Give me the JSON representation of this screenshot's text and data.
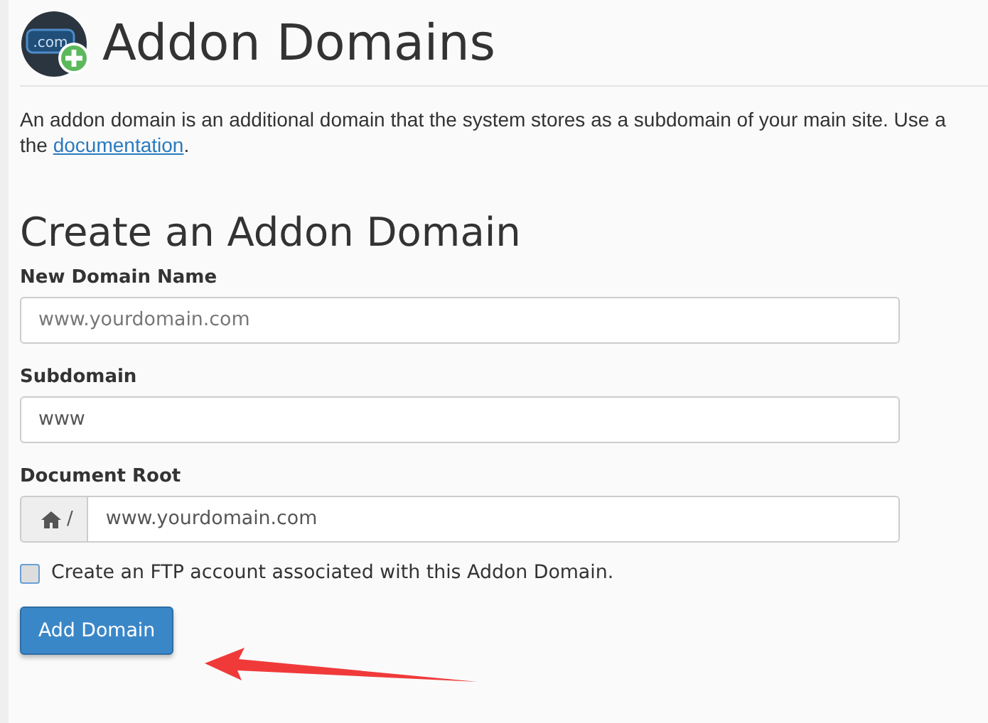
{
  "header": {
    "title": "Addon Domains",
    "icon_text": ".com"
  },
  "intro": {
    "text": "An addon domain is an additional domain that the system stores as a subdomain of your main site. Use a",
    "continuation": "the",
    "link": "documentation",
    "end": "."
  },
  "form": {
    "title": "Create an Addon Domain",
    "fields": [
      {
        "kind": "text",
        "label": "New Domain Name",
        "placeholder": "www.yourdomain.com"
      },
      {
        "kind": "text",
        "label": "Subdomain",
        "value": "www"
      },
      {
        "kind": "prefixed",
        "label": "Document Root",
        "prefix": "/",
        "value": "www.yourdomain.com"
      }
    ],
    "checkbox": {
      "label": "Create an FTP account associated with this Addon Domain.",
      "checked": false
    },
    "button": "Add Domain"
  },
  "annotation": {
    "kind": "arrow"
  }
}
